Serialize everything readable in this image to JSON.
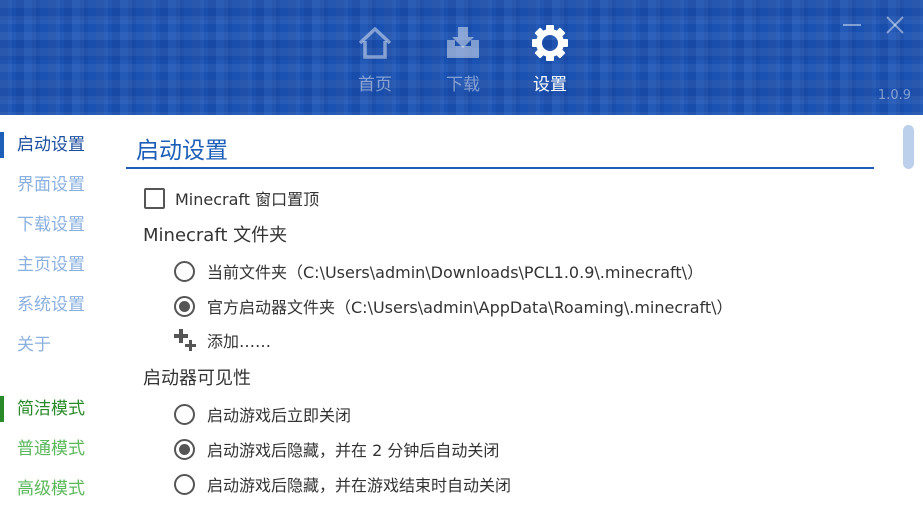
{
  "header": {
    "tabs": [
      {
        "label": "首页",
        "icon": "home-icon",
        "active": false
      },
      {
        "label": "下载",
        "icon": "download-tray-icon",
        "active": false
      },
      {
        "label": "设置",
        "icon": "gear-icon",
        "active": true
      }
    ],
    "version": "1.0.9",
    "colors": {
      "background": "#1a52b4",
      "inactive_label": "#8fa6d6",
      "active_label": "#ffffff"
    }
  },
  "sidebar": {
    "settings_items": [
      {
        "label": "启动设置",
        "active": true
      },
      {
        "label": "界面设置",
        "active": false
      },
      {
        "label": "下载设置",
        "active": false
      },
      {
        "label": "主页设置",
        "active": false
      },
      {
        "label": "系统设置",
        "active": false
      },
      {
        "label": "关于",
        "active": false
      }
    ],
    "mode_items": [
      {
        "label": "简洁模式",
        "active": true
      },
      {
        "label": "普通模式",
        "active": false
      },
      {
        "label": "高级模式",
        "active": false
      }
    ]
  },
  "main": {
    "title": "启动设置",
    "top_checkbox": {
      "label": "Minecraft 窗口置顶",
      "checked": false
    },
    "folder_group": {
      "label": "Minecraft 文件夹",
      "options": [
        {
          "label": "当前文件夹（C:\\Users\\admin\\Downloads\\PCL1.0.9\\.minecraft\\）",
          "checked": false
        },
        {
          "label": "官方启动器文件夹（C:\\Users\\admin\\AppData\\Roaming\\.minecraft\\）",
          "checked": true
        }
      ],
      "add_label": "添加……"
    },
    "visibility_group": {
      "label": "启动器可见性",
      "options": [
        {
          "label": "启动游戏后立即关闭",
          "checked": false
        },
        {
          "label": "启动游戏后隐藏，并在 2 分钟后自动关闭",
          "checked": true
        },
        {
          "label": "启动游戏后隐藏，并在游戏结束时自动关闭",
          "checked": false
        }
      ]
    }
  }
}
